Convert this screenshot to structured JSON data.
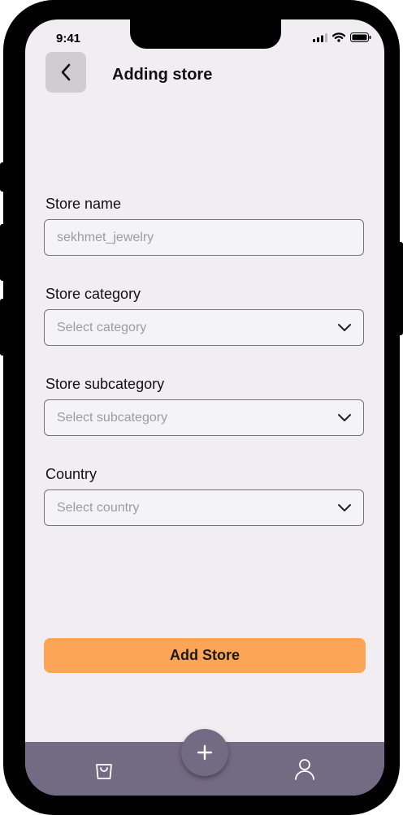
{
  "status_bar": {
    "time": "9:41"
  },
  "header": {
    "title": "Adding store"
  },
  "form": {
    "store_name": {
      "label": "Store name",
      "value": "sekhmet_jewelry"
    },
    "store_category": {
      "label": "Store category",
      "placeholder": "Select category"
    },
    "store_subcategory": {
      "label": "Store subcategory",
      "placeholder": "Select subcategory"
    },
    "country": {
      "label": "Country",
      "placeholder": "Select country"
    }
  },
  "actions": {
    "add_store_label": "Add Store"
  },
  "tabbar": {
    "items": [
      {
        "icon": "shopping-bag-icon"
      },
      {
        "icon": "plus-icon"
      },
      {
        "icon": "user-icon"
      }
    ]
  },
  "colors": {
    "background": "#f0eef0",
    "accent": "#fca557",
    "tabbar": "#736a83",
    "border": "#77707e",
    "placeholder": "#9f9aa3"
  }
}
